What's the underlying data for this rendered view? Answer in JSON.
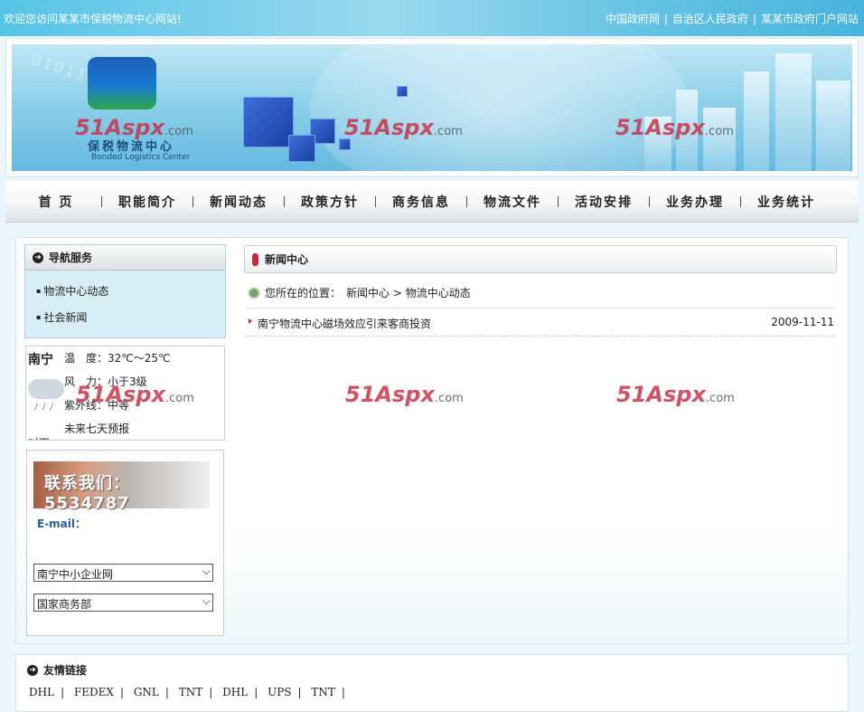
{
  "topbar": {
    "welcome": "欢迎您访问某某市保税物流中心网站!",
    "links": [
      "中国政府网",
      "自治区人民政府",
      "某某市政府门户网站"
    ]
  },
  "banner": {
    "logo_cn": "保税物流中心",
    "logo_en": "Bonded Logistics Center",
    "digits": "0101101",
    "watermarks": [
      "51Aspx",
      "51Aspx",
      "51Aspx"
    ],
    "watermark_suffix": ".com"
  },
  "nav": {
    "items": [
      "首  页",
      "职能简介",
      "新闻动态",
      "政策方针",
      "商务信息",
      "物流文件",
      "活动安排",
      "业务办理",
      "业务统计"
    ]
  },
  "sidebar": {
    "title": "导航服务",
    "items": [
      "物流中心动态",
      "社会新闻"
    ]
  },
  "weather": {
    "city": "南宁",
    "temp": "温　度：32℃～25℃",
    "wind": "风　力：小于3级",
    "uv": "紫外线：中等",
    "forecast": "未来七天预报",
    "cut_text": "对下",
    "drops": "ﾉﾉﾉ"
  },
  "contact": {
    "banner_text": "联系我们：5534787",
    "email_label": "E-mail：",
    "select1": "南宁中小企业网",
    "select2": "国家商务部"
  },
  "news": {
    "title": "新闻中心",
    "location_prefix": "您所在的位置：",
    "location_path": "新闻中心 > 物流中心动态",
    "items": [
      {
        "title": "南宁物流中心磁场效应引来客商投资",
        "date": "2009-11-11"
      }
    ]
  },
  "friends": {
    "title": "友情链接",
    "links": [
      "DHL",
      "FEDEX",
      "GNL",
      "TNT",
      "DHL",
      "UPS",
      "TNT"
    ]
  },
  "colors": {
    "accent_red": "#c8283a",
    "top_blue": "#55c4e7"
  }
}
